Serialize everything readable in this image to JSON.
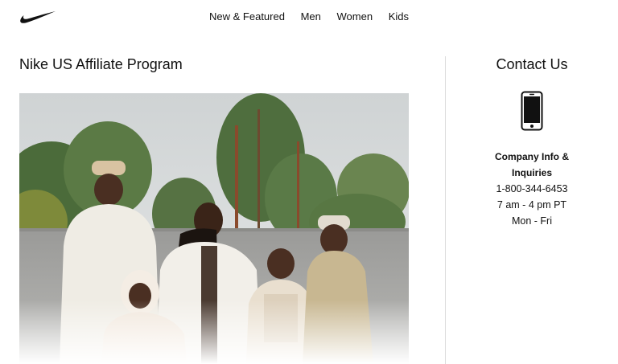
{
  "nav": {
    "items": [
      {
        "label": "New & Featured"
      },
      {
        "label": "Men"
      },
      {
        "label": "Women"
      },
      {
        "label": "Kids"
      }
    ]
  },
  "main": {
    "title": "Nike US Affiliate Program"
  },
  "contact": {
    "title": "Contact Us",
    "heading": "Company Info & Inquiries",
    "phone": "1-800-344-6453",
    "hours": "7 am - 4 pm PT",
    "days": "Mon - Fri"
  },
  "icons": {
    "logo": "nike-swoosh-logo",
    "phone": "smartphone-icon"
  },
  "colors": {
    "text": "#111111",
    "divider": "#dddddd",
    "background": "#ffffff"
  }
}
